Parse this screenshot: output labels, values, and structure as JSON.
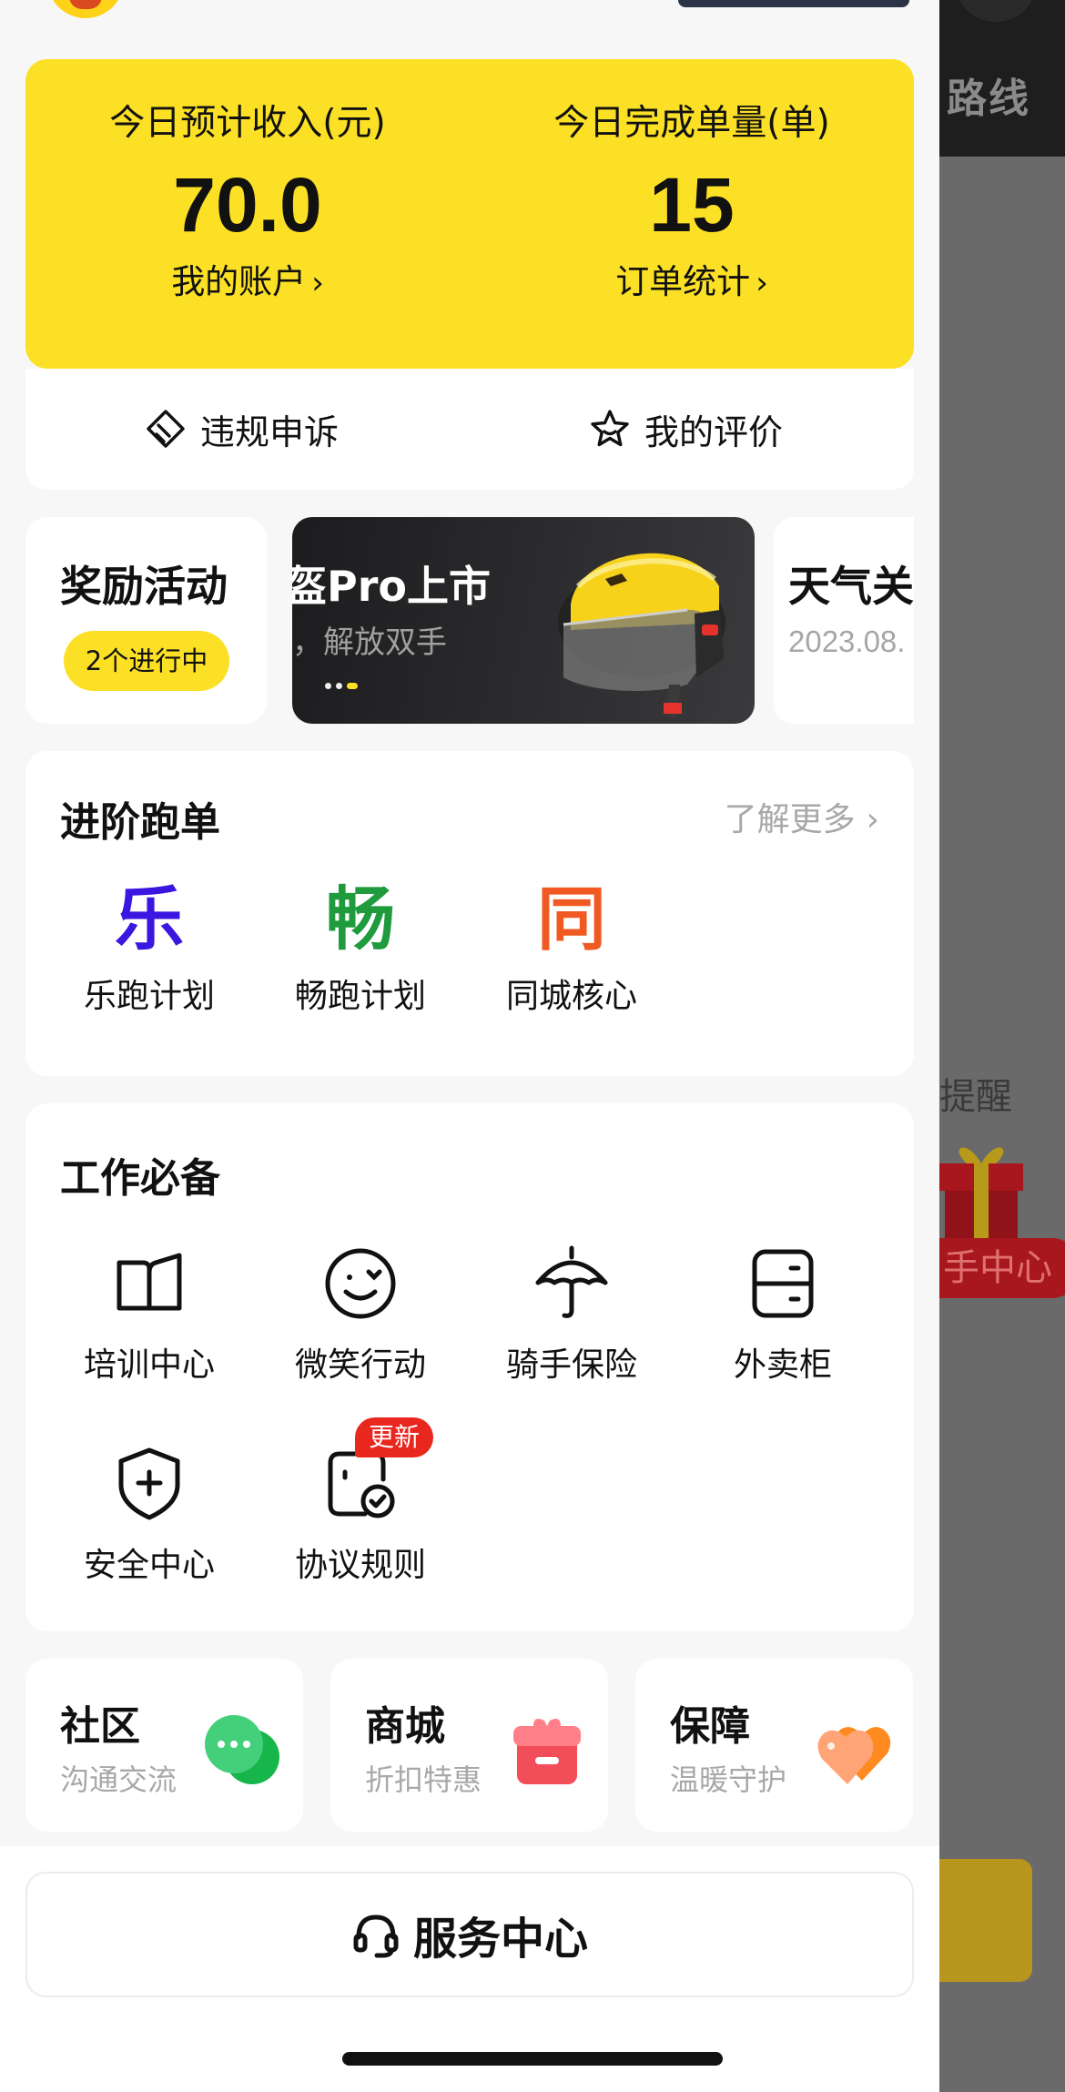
{
  "background_page": {
    "route_label": "路线",
    "remind_label": "提醒",
    "center_pill": "手中心"
  },
  "stats": {
    "income_label": "今日预计收入(元)",
    "income_value": "70.0",
    "account_link": "我的账户",
    "orders_label": "今日完成单量(单)",
    "orders_value": "15",
    "orders_link": "订单统计",
    "chevron": "›"
  },
  "actions": {
    "appeal": "违规申诉",
    "rating": "我的评价"
  },
  "reward": {
    "title": "奖励活动",
    "pill": "2个进行中"
  },
  "banner": {
    "title": "盔Pro上市",
    "subtitle": "，解放双手",
    "active_slide": 2,
    "slide_count": 3
  },
  "next_banner": {
    "title": "天气关",
    "date": "2023.08."
  },
  "advanced": {
    "title": "进阶跑单",
    "more": "了解更多",
    "items": [
      {
        "char": "乐",
        "label": "乐跑计划",
        "color": "#3a16e0"
      },
      {
        "char": "畅",
        "label": "畅跑计划",
        "color": "#1f9a3d"
      },
      {
        "char": "同",
        "label": "同城核心",
        "color": "#f05a22"
      }
    ]
  },
  "work": {
    "title": "工作必备",
    "items": [
      {
        "label": "培训中心",
        "icon": "book-icon"
      },
      {
        "label": "微笑行动",
        "icon": "smile-icon"
      },
      {
        "label": "骑手保险",
        "icon": "umbrella-icon"
      },
      {
        "label": "外卖柜",
        "icon": "locker-icon"
      },
      {
        "label": "安全中心",
        "icon": "shield-plus-icon"
      },
      {
        "label": "协议规则",
        "icon": "document-check-icon"
      }
    ],
    "badge": "更新"
  },
  "shortcuts": [
    {
      "title": "社区",
      "subtitle": "沟通交流",
      "icon": "chat-bubble-icon"
    },
    {
      "title": "商城",
      "subtitle": "折扣特惠",
      "icon": "gift-box-icon"
    },
    {
      "title": "保障",
      "subtitle": "温暖守护",
      "icon": "heart-icon"
    }
  ],
  "service": {
    "label": "服务中心",
    "icon": "headset-icon"
  },
  "colors": {
    "brand_yellow": "#fce025",
    "badge_red": "#e8271f",
    "dim_overlay": "#6a6a6a"
  }
}
